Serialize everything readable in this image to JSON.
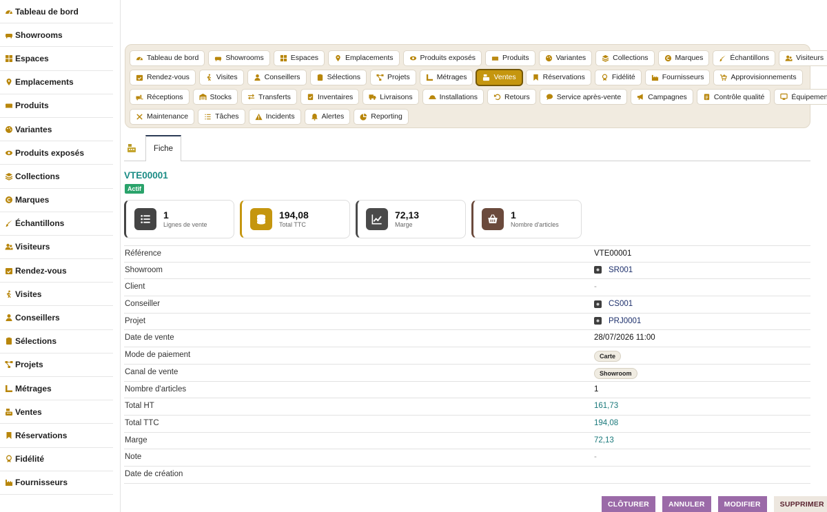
{
  "sidebar": {
    "items": [
      {
        "label": "Tableau de bord",
        "icon": "dashboard-icon"
      },
      {
        "label": "Showrooms",
        "icon": "couch-icon"
      },
      {
        "label": "Espaces",
        "icon": "grid-icon"
      },
      {
        "label": "Emplacements",
        "icon": "map-pin-icon"
      },
      {
        "label": "Produits",
        "icon": "sofa-icon"
      },
      {
        "label": "Variantes",
        "icon": "palette-icon"
      },
      {
        "label": "Produits exposés",
        "icon": "eye-icon"
      },
      {
        "label": "Collections",
        "icon": "layers-icon"
      },
      {
        "label": "Marques",
        "icon": "copyright-icon"
      },
      {
        "label": "Échantillons",
        "icon": "brush-icon"
      },
      {
        "label": "Visiteurs",
        "icon": "users-icon"
      },
      {
        "label": "Rendez-vous",
        "icon": "calendar-check-icon"
      },
      {
        "label": "Visites",
        "icon": "walking-icon"
      },
      {
        "label": "Conseillers",
        "icon": "user-tie-icon"
      },
      {
        "label": "Sélections",
        "icon": "clipboard-icon"
      },
      {
        "label": "Projets",
        "icon": "project-diagram-icon"
      },
      {
        "label": "Métrages",
        "icon": "ruler-icon"
      },
      {
        "label": "Ventes",
        "icon": "cash-register-icon"
      },
      {
        "label": "Réservations",
        "icon": "bookmark-icon"
      },
      {
        "label": "Fidélité",
        "icon": "award-icon"
      },
      {
        "label": "Fournisseurs",
        "icon": "industry-icon"
      }
    ]
  },
  "nav": {
    "rows": [
      [
        {
          "label": "Tableau de bord",
          "icon": "dashboard-icon"
        },
        {
          "label": "Showrooms",
          "icon": "couch-icon"
        },
        {
          "label": "Espaces",
          "icon": "grid-icon"
        },
        {
          "label": "Emplacements",
          "icon": "map-pin-icon"
        },
        {
          "label": "Produits exposés",
          "icon": "eye-icon"
        },
        {
          "label": "Produits",
          "icon": "sofa-icon"
        },
        {
          "label": "Variantes",
          "icon": "palette-icon"
        },
        {
          "label": "Collections",
          "icon": "layers-icon"
        },
        {
          "label": "Marques",
          "icon": "copyright-icon"
        },
        {
          "label": "Échantillons",
          "icon": "brush-icon"
        },
        {
          "label": "Visiteurs",
          "icon": "users-icon"
        }
      ],
      [
        {
          "label": "Rendez-vous",
          "icon": "calendar-check-icon"
        },
        {
          "label": "Visites",
          "icon": "walking-icon"
        },
        {
          "label": "Conseillers",
          "icon": "user-tie-icon"
        },
        {
          "label": "Sélections",
          "icon": "clipboard-icon"
        },
        {
          "label": "Projets",
          "icon": "project-diagram-icon"
        },
        {
          "label": "Métrages",
          "icon": "ruler-icon"
        },
        {
          "label": "Ventes",
          "icon": "cash-register-icon",
          "active": true
        },
        {
          "label": "Réservations",
          "icon": "bookmark-icon"
        },
        {
          "label": "Fidélité",
          "icon": "award-icon"
        },
        {
          "label": "Fournisseurs",
          "icon": "industry-icon"
        },
        {
          "label": "Approvisionnements",
          "icon": "cart-plus-icon"
        }
      ],
      [
        {
          "label": "Réceptions",
          "icon": "truck-loading-icon"
        },
        {
          "label": "Stocks",
          "icon": "warehouse-icon"
        },
        {
          "label": "Transferts",
          "icon": "exchange-icon"
        },
        {
          "label": "Inventaires",
          "icon": "clipboard-check-icon"
        },
        {
          "label": "Livraisons",
          "icon": "truck-icon"
        },
        {
          "label": "Installations",
          "icon": "hard-hat-icon"
        },
        {
          "label": "Retours",
          "icon": "undo-icon"
        },
        {
          "label": "Service après-vente",
          "icon": "comment-icon"
        },
        {
          "label": "Campagnes",
          "icon": "bullhorn-icon"
        },
        {
          "label": "Contrôle qualité",
          "icon": "clipboard-list-icon"
        },
        {
          "label": "Équipements",
          "icon": "desktop-icon"
        }
      ],
      [
        {
          "label": "Maintenance",
          "icon": "tools-icon"
        },
        {
          "label": "Tâches",
          "icon": "tasks-icon"
        },
        {
          "label": "Incidents",
          "icon": "warning-icon"
        },
        {
          "label": "Alertes",
          "icon": "bell-icon"
        },
        {
          "label": "Reporting",
          "icon": "chart-pie-icon"
        }
      ]
    ]
  },
  "tabs": {
    "icon": "cash-register-icon",
    "active": "Fiche"
  },
  "record": {
    "id": "VTE00001",
    "status": "Actif"
  },
  "stats": [
    {
      "value": "1",
      "label": "Lignes de vente",
      "icon": "list-icon",
      "color": "#444444"
    },
    {
      "value": "194,08",
      "label": "Total TTC",
      "icon": "coins-icon",
      "color": "#c5960f"
    },
    {
      "value": "72,13",
      "label": "Marge",
      "icon": "chart-line-icon",
      "color": "#4a4a4a"
    },
    {
      "value": "1",
      "label": "Nombre d'articles",
      "icon": "basket-icon",
      "color": "#6b4a3c"
    }
  ],
  "details": [
    {
      "label": "Référence",
      "value": "VTE00001",
      "kind": "text"
    },
    {
      "label": "Showroom",
      "value": "SR001",
      "kind": "link"
    },
    {
      "label": "Client",
      "value": "-",
      "kind": "dash"
    },
    {
      "label": "Conseiller",
      "value": "CS001",
      "kind": "link"
    },
    {
      "label": "Projet",
      "value": "PRJ0001",
      "kind": "link"
    },
    {
      "label": "Date de vente",
      "value": "28/07/2026 11:00",
      "kind": "text"
    },
    {
      "label": "Mode de paiement",
      "value": "Carte",
      "kind": "pill"
    },
    {
      "label": "Canal de vente",
      "value": "Showroom",
      "kind": "pill"
    },
    {
      "label": "Nombre d'articles",
      "value": "1",
      "kind": "text"
    },
    {
      "label": "Total HT",
      "value": "161,73",
      "kind": "num"
    },
    {
      "label": "Total TTC",
      "value": "194,08",
      "kind": "num"
    },
    {
      "label": "Marge",
      "value": "72,13",
      "kind": "num"
    },
    {
      "label": "Note",
      "value": "-",
      "kind": "dash"
    },
    {
      "label": "Date de création",
      "value": "",
      "kind": "text"
    }
  ],
  "actions": {
    "close": "CLÔTURER",
    "cancel": "ANNULER",
    "edit": "MODIFIER",
    "delete": "SUPPRIMER"
  },
  "colors": {
    "accent_gold": "#c5960f",
    "teal": "#1a8c85",
    "action_purple": "#9b6aa8",
    "status_green": "#2aa36b"
  }
}
